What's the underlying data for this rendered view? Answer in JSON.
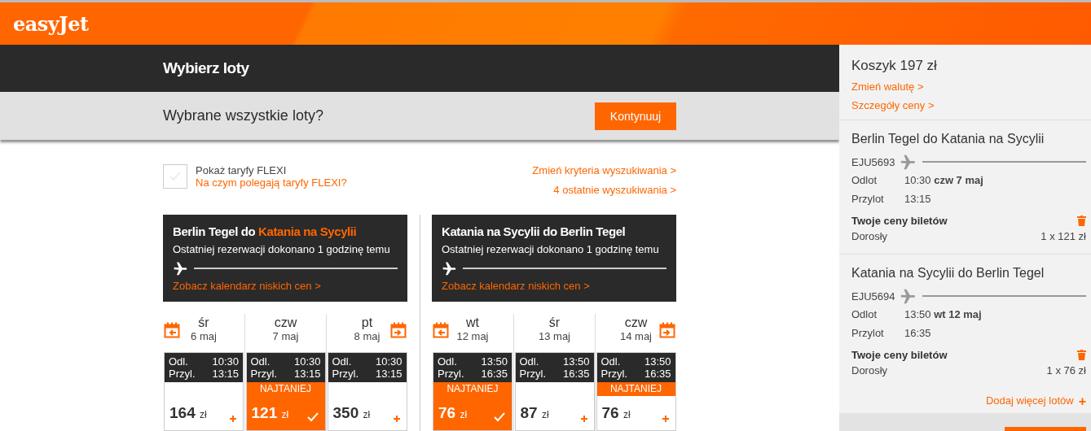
{
  "header": {
    "logo": "easyJet"
  },
  "page_title": "Wybierz loty",
  "confirm_bar": {
    "question": "Wybrane wszystkie loty?",
    "button": "Kontynuuj"
  },
  "flexi": {
    "checked": false,
    "label": "Pokaż taryfy FLEXI",
    "link": "Na czym polegają taryfy FLEXI?"
  },
  "search_links": [
    "Zmień kryteria wyszukiwania >",
    "4 ostatnie wyszukiwania >"
  ],
  "journeys": [
    {
      "title_parts": [
        {
          "text": "Berlin Tegel do ",
          "highlight": false
        },
        {
          "text": "Katania na Sycylii",
          "highlight": true
        }
      ],
      "booking_note": "Ostatniej rezerwacji dokonano 1 godzinę temu",
      "calendar_link": "Zobacz kalendarz niskich cen >",
      "days": [
        {
          "weekday": "śr",
          "date": "6 maj",
          "dep_label": "Odl.",
          "dep": "10:30",
          "arr_label": "Przyl.",
          "arr": "13:15",
          "cheapest": false,
          "selected": false,
          "price": "164",
          "currency": "zł"
        },
        {
          "weekday": "czw",
          "date": "7 maj",
          "dep_label": "Odl.",
          "dep": "10:30",
          "arr_label": "Przyl.",
          "arr": "13:15",
          "cheapest": true,
          "badge": "NAJTANIEJ",
          "selected": true,
          "price": "121",
          "currency": "zł"
        },
        {
          "weekday": "pt",
          "date": "8 maj",
          "dep_label": "Odl.",
          "dep": "10:30",
          "arr_label": "Przyl.",
          "arr": "13:15",
          "cheapest": false,
          "selected": false,
          "price": "350",
          "currency": "zł"
        }
      ]
    },
    {
      "title_parts": [
        {
          "text": "Katania na Sycylii do Berlin Tegel",
          "highlight": false
        }
      ],
      "booking_note": "Ostatniej rezerwacji dokonano 1 godzinę temu",
      "calendar_link": "Zobacz kalendarz niskich cen >",
      "days": [
        {
          "weekday": "wt",
          "date": "12 maj",
          "dep_label": "Odl.",
          "dep": "13:50",
          "arr_label": "Przyl.",
          "arr": "16:35",
          "cheapest": true,
          "badge": "NAJTANIEJ",
          "selected": true,
          "price": "76",
          "currency": "zł"
        },
        {
          "weekday": "śr",
          "date": "13 maj",
          "dep_label": "Odl.",
          "dep": "13:50",
          "arr_label": "Przyl.",
          "arr": "16:35",
          "cheapest": false,
          "selected": false,
          "price": "87",
          "currency": "zł"
        },
        {
          "weekday": "czw",
          "date": "14 maj",
          "dep_label": "Odl.",
          "dep": "13:50",
          "arr_label": "Przyl.",
          "arr": "16:35",
          "cheapest": true,
          "badge": "NAJTANIEJ",
          "selected": false,
          "price": "76",
          "currency": "zł"
        }
      ]
    }
  ],
  "basket": {
    "title": "Koszyk 197 zł",
    "links": [
      "Zmień walutę >",
      "Szczegóły ceny >"
    ],
    "flights": [
      {
        "route": "Berlin Tegel do Katania na Sycylii",
        "number": "EJU5693",
        "dep_label": "Odlot",
        "dep": "10:30 **czw 7 maj**",
        "arr_label": "Przylot",
        "arr": "13:15",
        "prices_title": "Twoje ceny biletów",
        "passenger": "Dorosły",
        "amount": "1 x 121 zł"
      },
      {
        "route": "Katania na Sycylii do Berlin Tegel",
        "number": "EJU5694",
        "dep_label": "Odlot",
        "dep": "13:50 **wt 12 maj**",
        "arr_label": "Przylot",
        "arr": "16:35",
        "prices_title": "Twoje ceny biletów",
        "passenger": "Dorosły",
        "amount": "1 x 76 zł"
      }
    ],
    "add_more": "Dodaj więcej lotów",
    "add_icon": "+"
  }
}
